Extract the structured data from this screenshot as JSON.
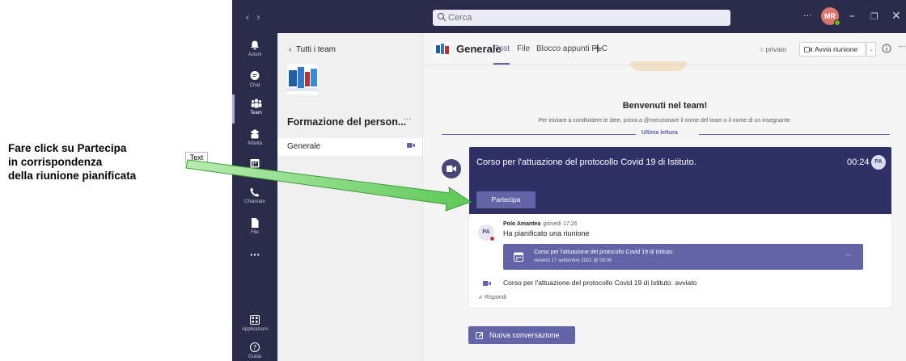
{
  "annotation": {
    "lines": [
      "Fare click su Partecipa",
      "in corrispondenza",
      "della riunione pianificata"
    ],
    "tag": "Text"
  },
  "titlebar": {
    "search_placeholder": "Cerca",
    "avatar_initials": "MR",
    "more": "···"
  },
  "rail": {
    "items": [
      {
        "label": "Azioni",
        "icon": "bell-icon"
      },
      {
        "label": "Chat",
        "icon": "chat-icon"
      },
      {
        "label": "Team",
        "icon": "team-icon"
      },
      {
        "label": "Attività",
        "icon": "assignments-icon"
      },
      {
        "label": "Calendario",
        "icon": "calendar-icon"
      },
      {
        "label": "Chiamate",
        "icon": "phone-icon"
      },
      {
        "label": "File",
        "icon": "file-icon"
      }
    ],
    "more": "···",
    "apps_label": "Applicazioni",
    "help_label": "Guida",
    "active": "Team"
  },
  "team_panel": {
    "back_label": "Tutti i team",
    "team_name": "Formazione del person...",
    "more": "···",
    "channel": "Generale"
  },
  "channel_header": {
    "name": "Generale",
    "tabs": [
      "Post",
      "File",
      "Blocco appunti PLC"
    ],
    "privacy": "privato",
    "meet_button": "Avvia riunione"
  },
  "content": {
    "welcome_title": "Benvenuti nel team!",
    "welcome_sub": "Per iniziare a condividere le idee, prova a @menzionare il nome del team o il nome di un insegnante.",
    "last_read": "Ultima lettura",
    "meeting": {
      "title": "Corso per l'attuazione del protocollo Covid 19 di Istituto.",
      "time": "00:24",
      "avatar": "PA",
      "join_label": "Partecipa"
    },
    "post": {
      "avatar": "PA",
      "author": "Polo Amantea",
      "when": "giovedì 17:26",
      "text": "Ha pianificato una riunione",
      "card_title": "Corso per l'attuazione del protocollo Covid 19 di Istituto.",
      "card_date": "venerdì 17 settembre 2021 @ 09:00",
      "card_more": "···",
      "started": "Corso per l'attuazione del protocollo Covid 19 di Istituto. avviato",
      "reply": "Rispondi"
    },
    "new_conversation": "Nuova conversazione"
  },
  "colors": {
    "titlebar": "#2b2b4a",
    "accent": "#6264a7",
    "meeting_card": "#2f3065",
    "arrow": "#7fd37a"
  }
}
